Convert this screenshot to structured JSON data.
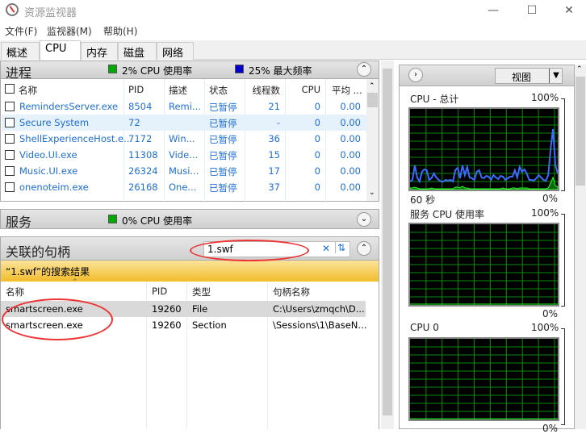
{
  "window": {
    "title": "资源监视器",
    "controls": [
      "minimize",
      "maximize",
      "close"
    ]
  },
  "menu": [
    "文件(F)",
    "监视器(M)",
    "帮助(H)"
  ],
  "tabs": [
    {
      "label": "概述"
    },
    {
      "label": "CPU",
      "active": true
    },
    {
      "label": "内存"
    },
    {
      "label": "磁盘"
    },
    {
      "label": "网络"
    }
  ],
  "processes": {
    "title": "进程",
    "cpu_usage": "2% CPU 使用率",
    "max_freq": "25% 最大频率",
    "columns": [
      "名称",
      "PID",
      "描述",
      "状态",
      "线程数",
      "CPU",
      "平均 ..."
    ],
    "rows": [
      {
        "name": "RemindersServer.exe",
        "pid": "8504",
        "desc": "Remi...",
        "status": "已暂停",
        "threads": "21",
        "cpu": "0",
        "avg": "0.00"
      },
      {
        "name": "Secure System",
        "pid": "72",
        "desc": "",
        "status": "已暂停",
        "threads": "-",
        "cpu": "0",
        "avg": "0.00"
      },
      {
        "name": "ShellExperienceHost.e...",
        "pid": "7172",
        "desc": "Win...",
        "status": "已暂停",
        "threads": "36",
        "cpu": "0",
        "avg": "0.00"
      },
      {
        "name": "Video.UI.exe",
        "pid": "11308",
        "desc": "Vide...",
        "status": "已暂停",
        "threads": "15",
        "cpu": "0",
        "avg": "0.00"
      },
      {
        "name": "Music.UI.exe",
        "pid": "26324",
        "desc": "Musi...",
        "status": "已暂停",
        "threads": "17",
        "cpu": "0",
        "avg": "0.00"
      },
      {
        "name": "onenoteim.exe",
        "pid": "26168",
        "desc": "One...",
        "status": "已暂停",
        "threads": "37",
        "cpu": "0",
        "avg": "0.00"
      }
    ]
  },
  "services": {
    "title": "服务",
    "cpu_usage": "0% CPU 使用率"
  },
  "handles": {
    "title": "关联的句柄",
    "search_value": "1.swf",
    "result_banner": "“1.swf”的搜索结果",
    "columns": [
      "名称",
      "PID",
      "类型",
      "句柄名称"
    ],
    "rows": [
      {
        "name": "smartscreen.exe",
        "pid": "19260",
        "type": "File",
        "handle": "C:\\Users\\zmqch\\D..."
      },
      {
        "name": "smartscreen.exe",
        "pid": "19260",
        "type": "Section",
        "handle": "\\Sessions\\1\\BaseN..."
      }
    ]
  },
  "right": {
    "view_label": "视图",
    "graphs": [
      {
        "title": "CPU - 总计",
        "max": "100%",
        "time": "60 秒",
        "min": "0%",
        "blue": [
          10,
          12,
          30,
          15,
          10,
          22,
          25,
          24,
          12,
          14,
          20,
          15,
          12,
          10,
          10,
          12,
          11,
          12,
          10,
          24,
          27,
          14,
          30,
          18,
          28,
          15,
          14,
          12,
          22,
          24,
          15,
          14,
          17,
          16,
          12,
          18,
          15,
          13,
          17,
          16,
          12,
          14,
          16,
          16,
          24,
          15,
          28,
          22,
          25,
          20,
          12,
          12,
          11,
          14,
          18,
          15,
          12,
          11,
          18,
          50,
          75,
          30,
          20
        ],
        "green": [
          2,
          2,
          3,
          2,
          1,
          1,
          1,
          1,
          1,
          2,
          1,
          1,
          1,
          1,
          1,
          1,
          1,
          1,
          1,
          3,
          3,
          2,
          4,
          2,
          2,
          1,
          1,
          1,
          1,
          1,
          1,
          1,
          1,
          1,
          1,
          1,
          1,
          1,
          1,
          2,
          1,
          1,
          1,
          2,
          2,
          1,
          2,
          2,
          2,
          2,
          1,
          1,
          1,
          1,
          1,
          1,
          1,
          1,
          2,
          8,
          15,
          5,
          3
        ]
      },
      {
        "title": "服务 CPU 使用率",
        "max": "100%",
        "min": "0%"
      },
      {
        "title": "CPU 0",
        "max": "100%",
        "min": "0%"
      }
    ]
  },
  "colors": {
    "accent": "#1e6ed6",
    "graph_line": "#3b6cff",
    "graph_grid": "#0a8a0a",
    "banner": "#f5c842",
    "annotation": "#e33333"
  }
}
